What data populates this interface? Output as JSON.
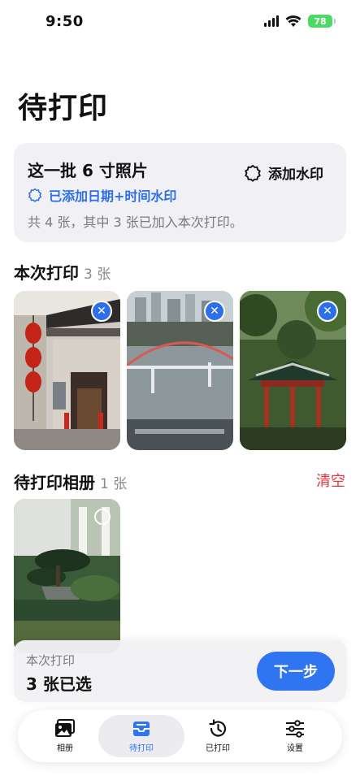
{
  "status_bar": {
    "time": "9:50",
    "battery": "78"
  },
  "page_title": "待打印",
  "info_card": {
    "batch_title": "这一批 6 寸照片",
    "watermark_status": "已添加日期+时间水印",
    "summary": "共 4 张，其中 3 张已加入本次打印。",
    "add_watermark_label": "添加水印"
  },
  "current_print": {
    "title": "本次打印",
    "count": "3 张",
    "photos": [
      {
        "subject": "old-building-lanterns"
      },
      {
        "subject": "river-bridge"
      },
      {
        "subject": "red-pavilion"
      }
    ]
  },
  "pending_album": {
    "title": "待打印相册",
    "count": "1 张",
    "clear_label": "清空",
    "photos": [
      {
        "subject": "garden-bonsai"
      }
    ]
  },
  "selection_bar": {
    "label": "本次打印",
    "value": "3 张已选",
    "next_label": "下一步"
  },
  "tabbar": {
    "items": [
      {
        "label": "相册",
        "icon": "photos-icon"
      },
      {
        "label": "待打印",
        "icon": "tray-icon"
      },
      {
        "label": "已打印",
        "icon": "history-icon"
      },
      {
        "label": "设置",
        "icon": "sliders-icon"
      }
    ],
    "active_index": 1
  },
  "colors": {
    "accent": "#2f74f0",
    "danger": "#e0363c",
    "battery": "#4cd964"
  }
}
